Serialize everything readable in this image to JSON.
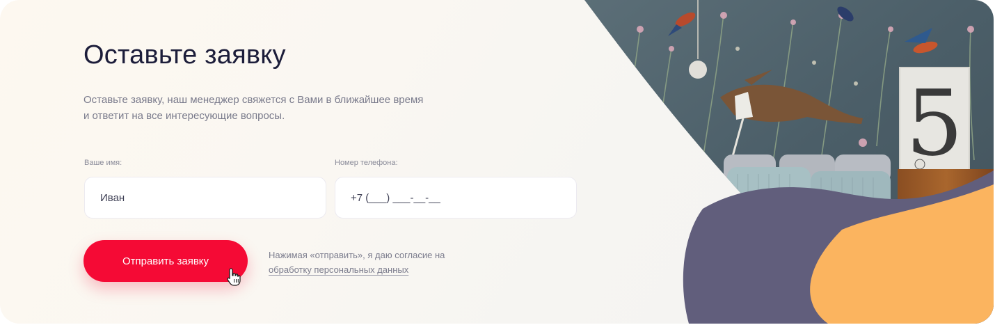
{
  "form": {
    "title": "Оставьте заявку",
    "subtitle": "Оставьте заявку, наш менеджер свяжется с Вами в ближайшее время и ответит на все интересующие вопросы.",
    "name_label": "Ваше имя:",
    "name_value": "Иван",
    "phone_label": "Номер телефона:",
    "phone_placeholder": "+7 (___) ___-__-__",
    "submit_label": "Отправить заявку",
    "consent_text": "Нажимая «отправить», я даю согласие на",
    "consent_link": "обработку персональных данных"
  },
  "image": {
    "poster_digit": "5"
  },
  "colors": {
    "accent": "#f50a35",
    "title": "#1c1d3a",
    "muted": "#7a7b8c",
    "blob_purple": "#615e7c",
    "blob_orange": "#fbb45f",
    "wallpaper": "#4a5d66"
  },
  "icons": {
    "cursor": "hand-pointer-icon"
  }
}
